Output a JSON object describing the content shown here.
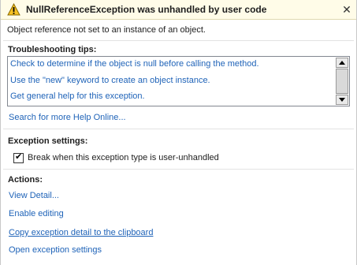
{
  "title_bar": {
    "title": "NullReferenceException was unhandled by user code",
    "icon": "warning-icon",
    "close_label": "✕"
  },
  "message": "Object reference not set to an instance of an object.",
  "troubleshooting": {
    "heading": "Troubleshooting tips:",
    "tips": [
      "Check to determine if the object is null before calling the method.",
      "Use the \"new\" keyword to create an object instance.",
      "Get general help for this exception."
    ],
    "search_link": "Search for more Help Online..."
  },
  "exception_settings": {
    "heading": "Exception settings:",
    "checkbox_label": "Break when this exception type is user-unhandled",
    "checked": true
  },
  "actions": {
    "heading": "Actions:",
    "items": [
      "View Detail...",
      "Enable editing",
      "Copy exception detail to the clipboard",
      "Open exception settings"
    ]
  },
  "colors": {
    "link": "#1f63b8",
    "title_background": "#fffce8"
  }
}
